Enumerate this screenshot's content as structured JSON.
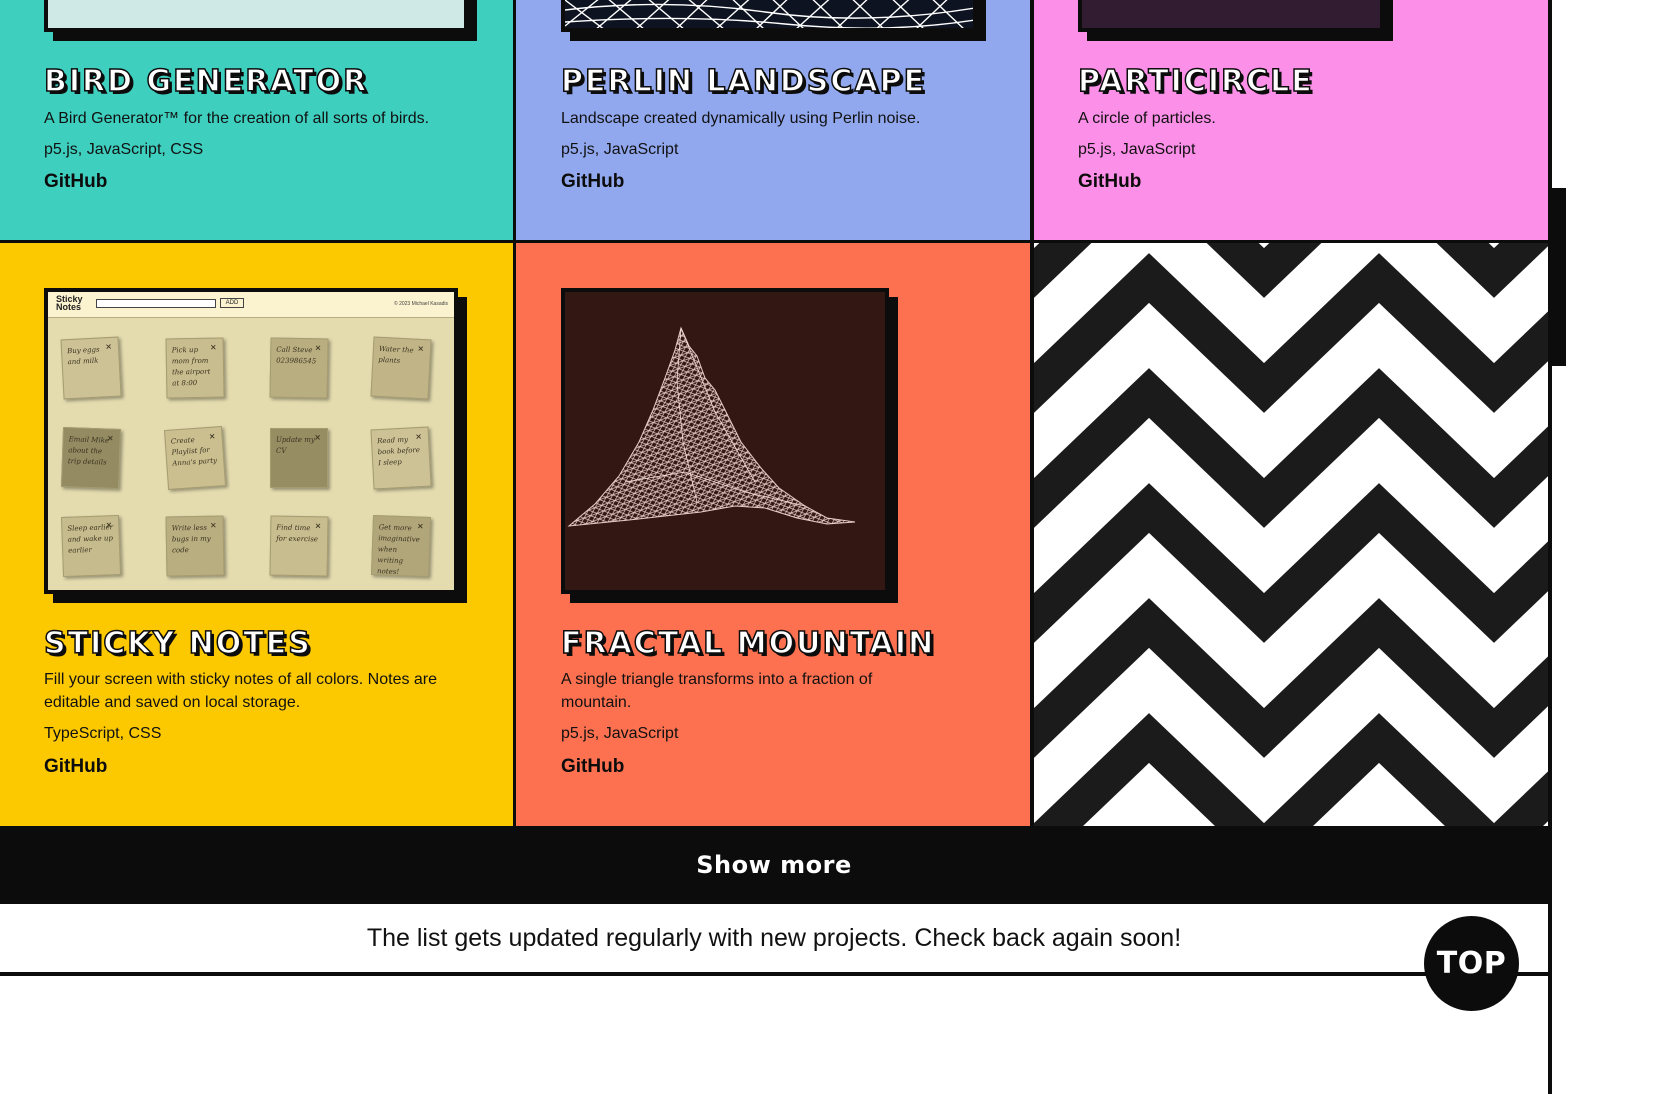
{
  "projects": [
    {
      "title": "BIRD GENERATOR",
      "description": "A Bird Generator™ for the creation of all sorts of birds.",
      "tech": "p5.js, JavaScript, CSS",
      "link": "GitHub",
      "color": "#3ecfbf"
    },
    {
      "title": "PERLIN LANDSCAPE",
      "description": "Landscape created dynamically using Perlin noise.",
      "tech": "p5.js, JavaScript",
      "link": "GitHub",
      "color": "#91a8ee"
    },
    {
      "title": "PARTICIRCLE",
      "description": "A circle of particles.",
      "tech": "p5.js, JavaScript",
      "link": "GitHub",
      "color": "#fc8fe8"
    },
    {
      "title": "STICKY NOTES",
      "description": "Fill your screen with sticky notes of all colors. Notes are editable and saved on local storage.",
      "tech": "TypeScript, CSS",
      "link": "GitHub",
      "color": "#fcc800"
    },
    {
      "title": "FRACTAL MOUNTAIN",
      "description": "A single triangle transforms into a fraction of mountain.",
      "tech": "p5.js, JavaScript",
      "link": "GitHub",
      "color": "#fd7050"
    }
  ],
  "sticky_preview": {
    "logo": "Sticky Notes",
    "add_label": "ADD",
    "copyright": "© 2023 Michael Kasadis",
    "notes": [
      "Buy eggs and milk",
      "Pick up mom from the airport at 8:00",
      "Call Steve 023986545",
      "Water the plants",
      "Email Mike about the trip details",
      "Create Playlist for Anna's party",
      "Update my CV",
      "Read my book before I sleep",
      "Sleep earlier and wake up earlier",
      "Write less bugs in my code",
      "Find time for exercise",
      "Get more imaginative when writing notes!"
    ],
    "note_colors": [
      "#cdc296",
      "#c8bd8e",
      "#b9ae80",
      "#c1b588",
      "#948b62",
      "#cbbf90",
      "#968d63",
      "#cdc296",
      "#c6bb8c",
      "#b9ae80",
      "#c8bd8e",
      "#b1a67a"
    ]
  },
  "show_more_label": "Show more",
  "footer_note": "The list gets updated regularly with new projects. Check back again soon!",
  "top_button_label": "TOP",
  "icons": {
    "zigzag": "zigzag-pattern",
    "mountain": "wireframe-mountain-icon",
    "landscape": "perlin-grid-icon"
  }
}
